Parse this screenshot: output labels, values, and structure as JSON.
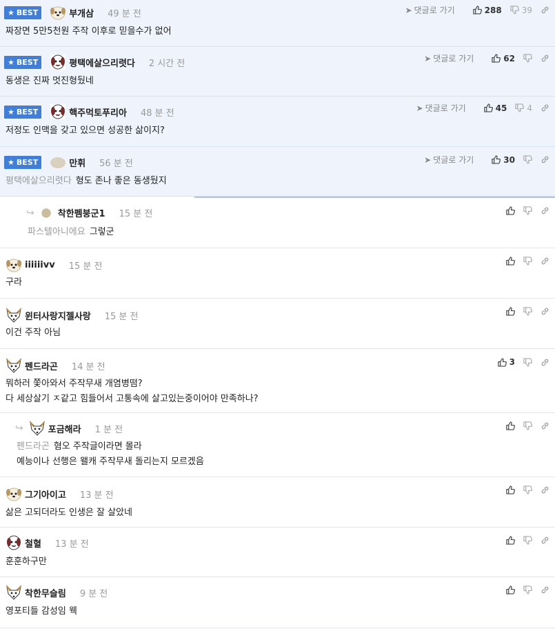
{
  "ui": {
    "best_label": "BEST",
    "reply_link_label": "댓글로 가기"
  },
  "comments": [
    {
      "nick": "부개삼",
      "time": "49 분 전",
      "text": "짜장면 5만5천원 주작 이후로 믿을수가 없어",
      "up": "288",
      "down": "39"
    },
    {
      "nick": "평택에살으리렷다",
      "time": "2 시간 전",
      "text": "동생은 진짜 멋진형뒀네",
      "up": "62",
      "down": ""
    },
    {
      "nick": "핵주먹토푸리아",
      "time": "48 분 전",
      "text": "저정도 인맥을 갖고 있으면 성공한 삶이지?",
      "up": "45",
      "down": "4"
    },
    {
      "nick": "만휘",
      "time": "56 분 전",
      "mention": "평택에살으리렷다",
      "text": "형도 존나 좋은 동생뒀지",
      "up": "30",
      "down": ""
    },
    {
      "nick": "착한펨붕군1",
      "time": "15 분 전",
      "mention": "파스텔아니에요",
      "text": "그렇군",
      "up": ""
    },
    {
      "nick": "iiiiiivv",
      "time": "15 분 전",
      "text": "구라",
      "up": ""
    },
    {
      "nick": "윈터사랑지젤사랑",
      "time": "15 분 전",
      "text": "이건 주작 아님",
      "up": ""
    },
    {
      "nick": "펜드라곤",
      "time": "14 분 전",
      "text": "뭐하러 쫓아와서 주작무새 개염병떰?",
      "text2": "다 세상살기 ㅈ같고 힘들어서 고통속에 살고있는중이어야 만족하나?",
      "up": "3"
    },
    {
      "nick": "포금해라",
      "time": "1 분 전",
      "mention": "펜드라곤",
      "text": "혐오 주작글이라면 몰라",
      "text2": "예능이나 선행은 왤캐 주작무새 돌리는지 모르겠음",
      "up": ""
    },
    {
      "nick": "그기아이고",
      "time": "13 분 전",
      "text": "삶은 고되더라도 인생은 잘 살았네",
      "up": ""
    },
    {
      "nick": "철혈",
      "time": "13 분 전",
      "text": "훈훈하구만",
      "up": ""
    },
    {
      "nick": "착한무슬림",
      "time": "9 분 전",
      "text": "영포티들 감성임 웩",
      "up": ""
    }
  ]
}
